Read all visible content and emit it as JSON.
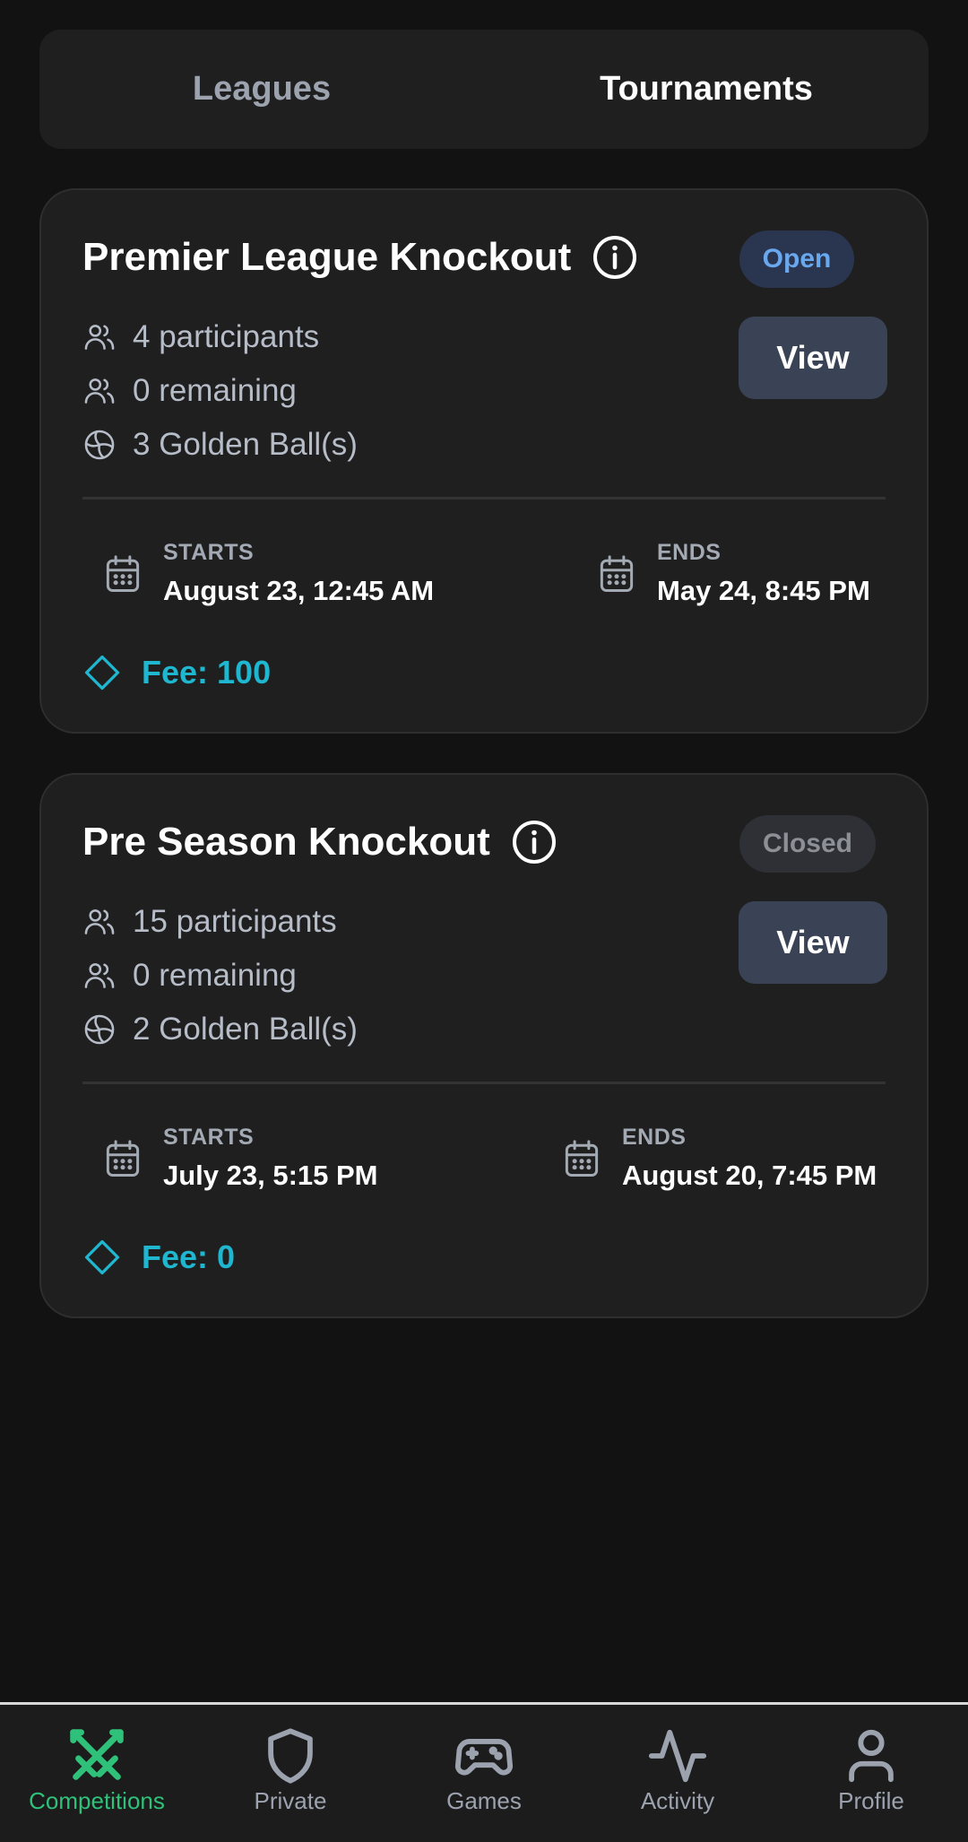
{
  "tabs": [
    {
      "label": "Leagues",
      "active": false
    },
    {
      "label": "Tournaments",
      "active": true
    }
  ],
  "cards": [
    {
      "title": "Premier League Knockout",
      "status": "Open",
      "view_label": "View",
      "participants": "4 participants",
      "remaining": "0 remaining",
      "golden_balls": "3 Golden Ball(s)",
      "starts_label": "STARTS",
      "starts_value": "August 23, 12:45 AM",
      "ends_label": "ENDS",
      "ends_value": "May 24, 8:45 PM",
      "fee": "Fee: 100"
    },
    {
      "title": "Pre Season Knockout",
      "status": "Closed",
      "view_label": "View",
      "participants": "15 participants",
      "remaining": "0 remaining",
      "golden_balls": "2 Golden Ball(s)",
      "starts_label": "STARTS",
      "starts_value": "July 23, 5:15 PM",
      "ends_label": "ENDS",
      "ends_value": "August 20, 7:45 PM",
      "fee": "Fee: 0"
    }
  ],
  "nav": [
    {
      "label": "Competitions",
      "icon": "crossed-swords-icon",
      "active": true
    },
    {
      "label": "Private",
      "icon": "shield-icon",
      "active": false
    },
    {
      "label": "Games",
      "icon": "gamepad-icon",
      "active": false
    },
    {
      "label": "Activity",
      "icon": "activity-icon",
      "active": false
    },
    {
      "label": "Profile",
      "icon": "user-icon",
      "active": false
    }
  ],
  "colors": {
    "background": "#121212",
    "card": "#1f1f1f",
    "accent_fee": "#1fb6cf",
    "accent_nav": "#2fc17a",
    "badge_open_text": "#6aa8ee",
    "badge_closed_text": "#8c9096"
  }
}
